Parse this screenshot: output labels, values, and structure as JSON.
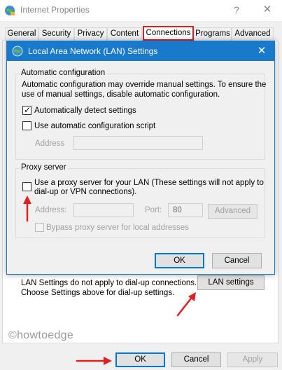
{
  "window": {
    "title": "Internet Properties",
    "help_glyph": "?",
    "close_glyph": "✕"
  },
  "tabs": [
    {
      "label": "General"
    },
    {
      "label": "Security"
    },
    {
      "label": "Privacy"
    },
    {
      "label": "Content"
    },
    {
      "label": "Connections",
      "active": true
    },
    {
      "label": "Programs"
    },
    {
      "label": "Advanced"
    }
  ],
  "connections": {
    "lan_note_line1": "LAN Settings do not apply to dial-up connections.",
    "lan_note_line2": "Choose Settings above for dial-up settings.",
    "lan_settings_label": "LAN settings"
  },
  "watermark": "©howtoedge",
  "footer": {
    "ok_label": "OK",
    "cancel_label": "Cancel",
    "apply_label": "Apply"
  },
  "dialog": {
    "title": "Local Area Network (LAN) Settings",
    "close_glyph": "✕",
    "auto_config": {
      "group_label": "Automatic configuration",
      "description_line1": "Automatic configuration may override manual settings.  To ensure the",
      "description_line2": "use of manual settings, disable automatic configuration.",
      "auto_detect_label": "Automatically detect settings",
      "auto_detect_checked": true,
      "script_label": "Use automatic configuration script",
      "script_checked": false,
      "address_label": "Address",
      "address_value": ""
    },
    "proxy": {
      "group_label": "Proxy server",
      "use_proxy_line1": "Use a proxy server for your LAN (These settings will not apply to",
      "use_proxy_line2": "dial-up or VPN connections).",
      "use_proxy_checked": false,
      "address_label": "Address:",
      "address_value": "",
      "port_label": "Port:",
      "port_value": "80",
      "advanced_label": "Advanced",
      "bypass_label": "Bypass proxy server for local addresses",
      "bypass_checked": false
    },
    "ok_label": "OK",
    "cancel_label": "Cancel"
  },
  "colors": {
    "dialog_titlebar": "#1979ca",
    "highlight_red": "#e02020",
    "default_button_border": "#0078d7"
  }
}
